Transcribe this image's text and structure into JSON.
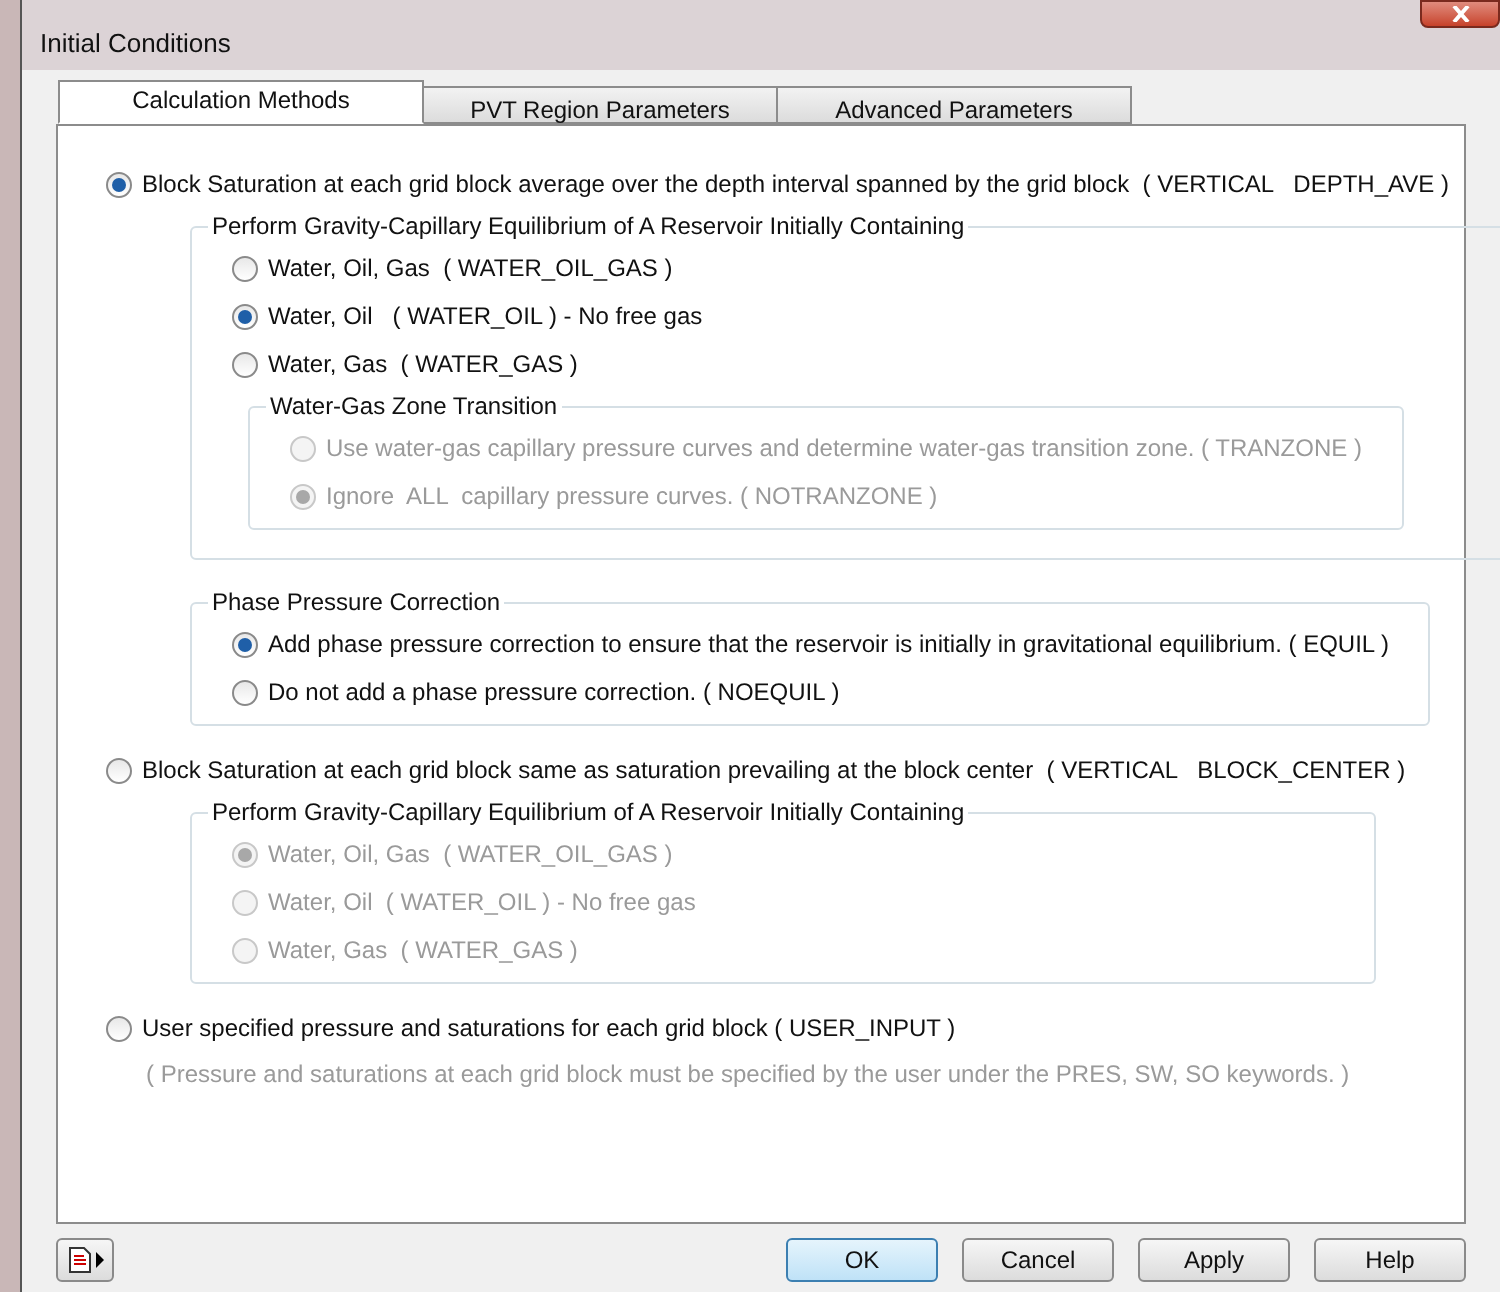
{
  "window": {
    "title": "Initial Conditions"
  },
  "tabs": [
    {
      "label": "Calculation Methods",
      "selected": true
    },
    {
      "label": "PVT Region Parameters",
      "selected": false
    },
    {
      "label": "Advanced Parameters",
      "selected": false
    }
  ],
  "options": [
    {
      "kind": "radio",
      "label": "Block Saturation at each grid block average over the depth interval spanned by the grid block  ( VERTICAL   DEPTH_AVE )",
      "selected": true,
      "disabled": false,
      "groups": [
        {
          "title": "Perform Gravity-Capillary Equilibrium of A Reservoir Initially Containing",
          "items": [
            {
              "kind": "radio",
              "label": "Water, Oil, Gas  ( WATER_OIL_GAS )",
              "selected": false,
              "disabled": false
            },
            {
              "kind": "radio",
              "label": "Water, Oil   ( WATER_OIL ) - No free gas",
              "selected": true,
              "disabled": false
            },
            {
              "kind": "radio",
              "label": "Water, Gas  ( WATER_GAS )",
              "selected": false,
              "disabled": false,
              "groups": [
                {
                  "title": "Water-Gas Zone Transition",
                  "items": [
                    {
                      "kind": "radio",
                      "label": "Use water-gas capillary pressure curves and determine water-gas transition zone. ( TRANZONE )",
                      "selected": false,
                      "disabled": true
                    },
                    {
                      "kind": "radio",
                      "label": "Ignore  ALL  capillary pressure curves. ( NOTRANZONE )",
                      "selected": true,
                      "disabled": true
                    }
                  ]
                }
              ]
            }
          ]
        },
        {
          "title": "Phase Pressure Correction",
          "items": [
            {
              "kind": "radio",
              "label": "Add phase pressure correction to ensure that the reservoir is initially in gravitational equilibrium. ( EQUIL )",
              "selected": true,
              "disabled": false
            },
            {
              "kind": "radio",
              "label": "Do not add a phase pressure correction. ( NOEQUIL )",
              "selected": false,
              "disabled": false
            }
          ]
        }
      ]
    },
    {
      "kind": "radio",
      "label": "Block Saturation at each grid block same as saturation prevailing at the block center  ( VERTICAL   BLOCK_CENTER )",
      "selected": false,
      "disabled": false,
      "groups": [
        {
          "title": "Perform Gravity-Capillary Equilibrium of A Reservoir Initially Containing",
          "items": [
            {
              "kind": "radio",
              "label": "Water, Oil, Gas  ( WATER_OIL_GAS )",
              "selected": true,
              "disabled": true
            },
            {
              "kind": "radio",
              "label": "Water, Oil  ( WATER_OIL ) - No free gas",
              "selected": false,
              "disabled": true
            },
            {
              "kind": "radio",
              "label": "Water, Gas  ( WATER_GAS )",
              "selected": false,
              "disabled": true
            }
          ]
        }
      ]
    },
    {
      "kind": "radio",
      "label": "User specified pressure and saturations for each grid block ( USER_INPUT )",
      "selected": false,
      "disabled": false
    },
    {
      "kind": "note",
      "label": "( Pressure and saturations at each grid block must be specified by the user under the PRES, SW, SO keywords. )"
    }
  ],
  "buttons": [
    {
      "label": "OK",
      "default": true
    },
    {
      "label": "Cancel",
      "default": false
    },
    {
      "label": "Apply",
      "default": false
    },
    {
      "label": "Help",
      "default": false
    }
  ]
}
